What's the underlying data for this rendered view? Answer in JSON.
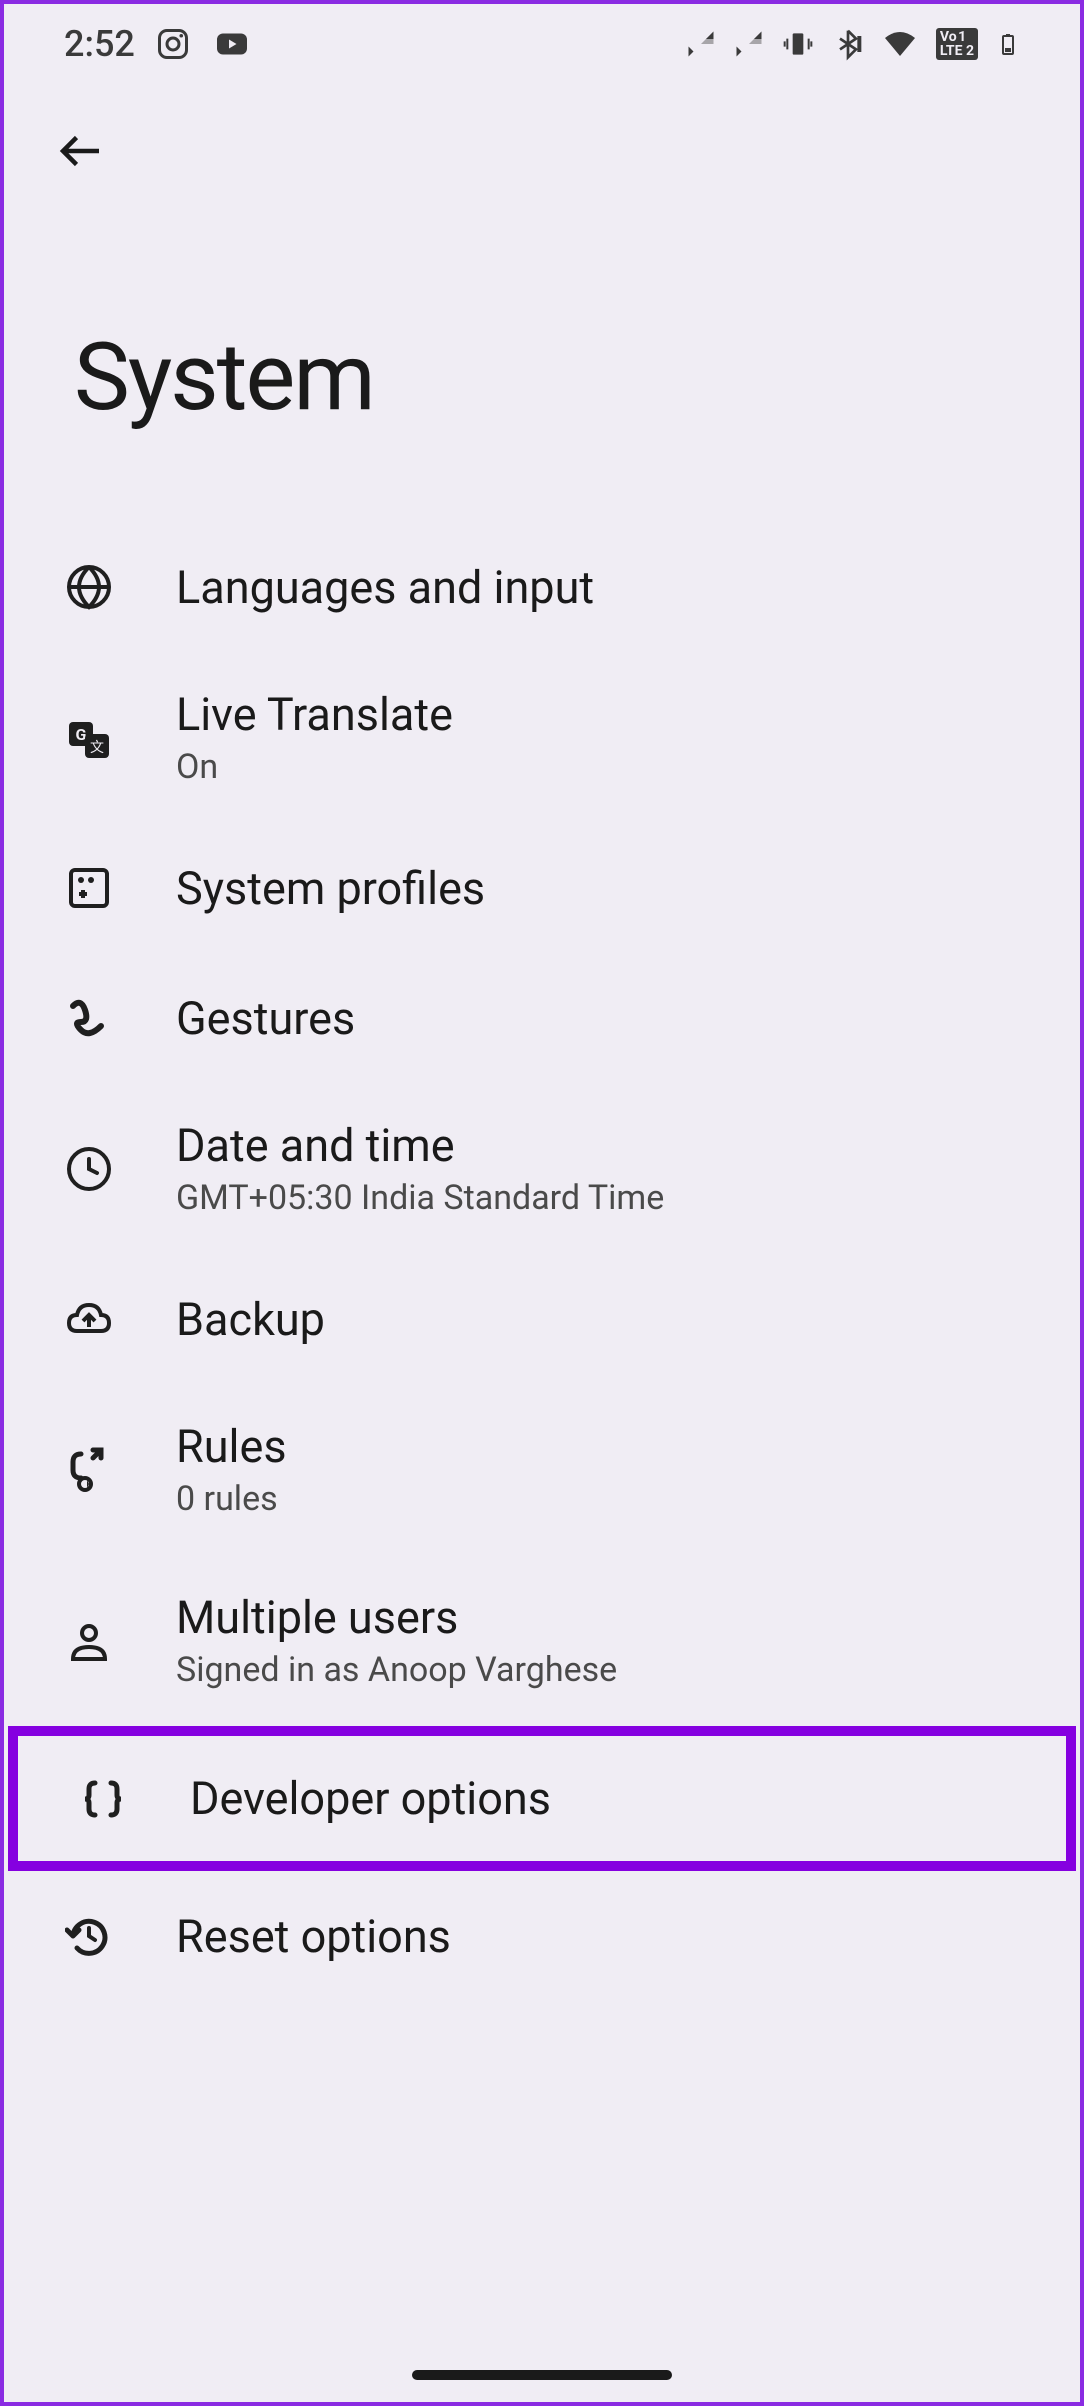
{
  "status": {
    "time": "2:52"
  },
  "page": {
    "title": "System"
  },
  "items": [
    {
      "title": "Languages and input",
      "subtitle": null
    },
    {
      "title": "Live Translate",
      "subtitle": "On"
    },
    {
      "title": "System profiles",
      "subtitle": null
    },
    {
      "title": "Gestures",
      "subtitle": null
    },
    {
      "title": "Date and time",
      "subtitle": "GMT+05:30 India Standard Time"
    },
    {
      "title": "Backup",
      "subtitle": null
    },
    {
      "title": "Rules",
      "subtitle": "0 rules"
    },
    {
      "title": "Multiple users",
      "subtitle": "Signed in as Anoop Varghese"
    },
    {
      "title": "Developer options",
      "subtitle": null
    },
    {
      "title": "Reset options",
      "subtitle": null
    }
  ]
}
